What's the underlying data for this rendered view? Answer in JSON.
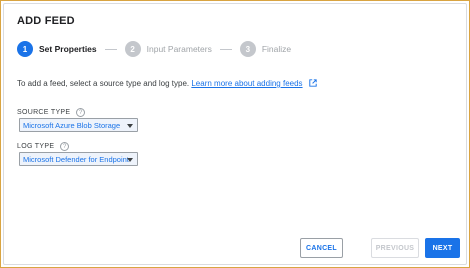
{
  "dialog": {
    "title": "ADD FEED"
  },
  "stepper": {
    "steps": [
      {
        "number": "1",
        "label": "Set Properties",
        "state": "active"
      },
      {
        "number": "2",
        "label": "Input Parameters",
        "state": "inactive"
      },
      {
        "number": "3",
        "label": "Finalize",
        "state": "inactive"
      }
    ]
  },
  "intro": {
    "text": "To add a feed, select a source type and log type.",
    "link": "Learn more about adding feeds"
  },
  "source_type": {
    "label": "SOURCE TYPE",
    "value": "Microsoft Azure Blob Storage"
  },
  "log_type": {
    "label": "LOG TYPE",
    "value": "Microsoft Defender for Endpoint"
  },
  "buttons": {
    "cancel": "CANCEL",
    "previous": "PREVIOUS",
    "next": "NEXT"
  },
  "icons": {
    "help": "help-circle-icon",
    "external": "external-link-icon",
    "caret": "caret-down-icon"
  },
  "colors": {
    "accent": "#1a73e8",
    "frame": "#d9a441",
    "inactive": "#c4c7cc"
  }
}
